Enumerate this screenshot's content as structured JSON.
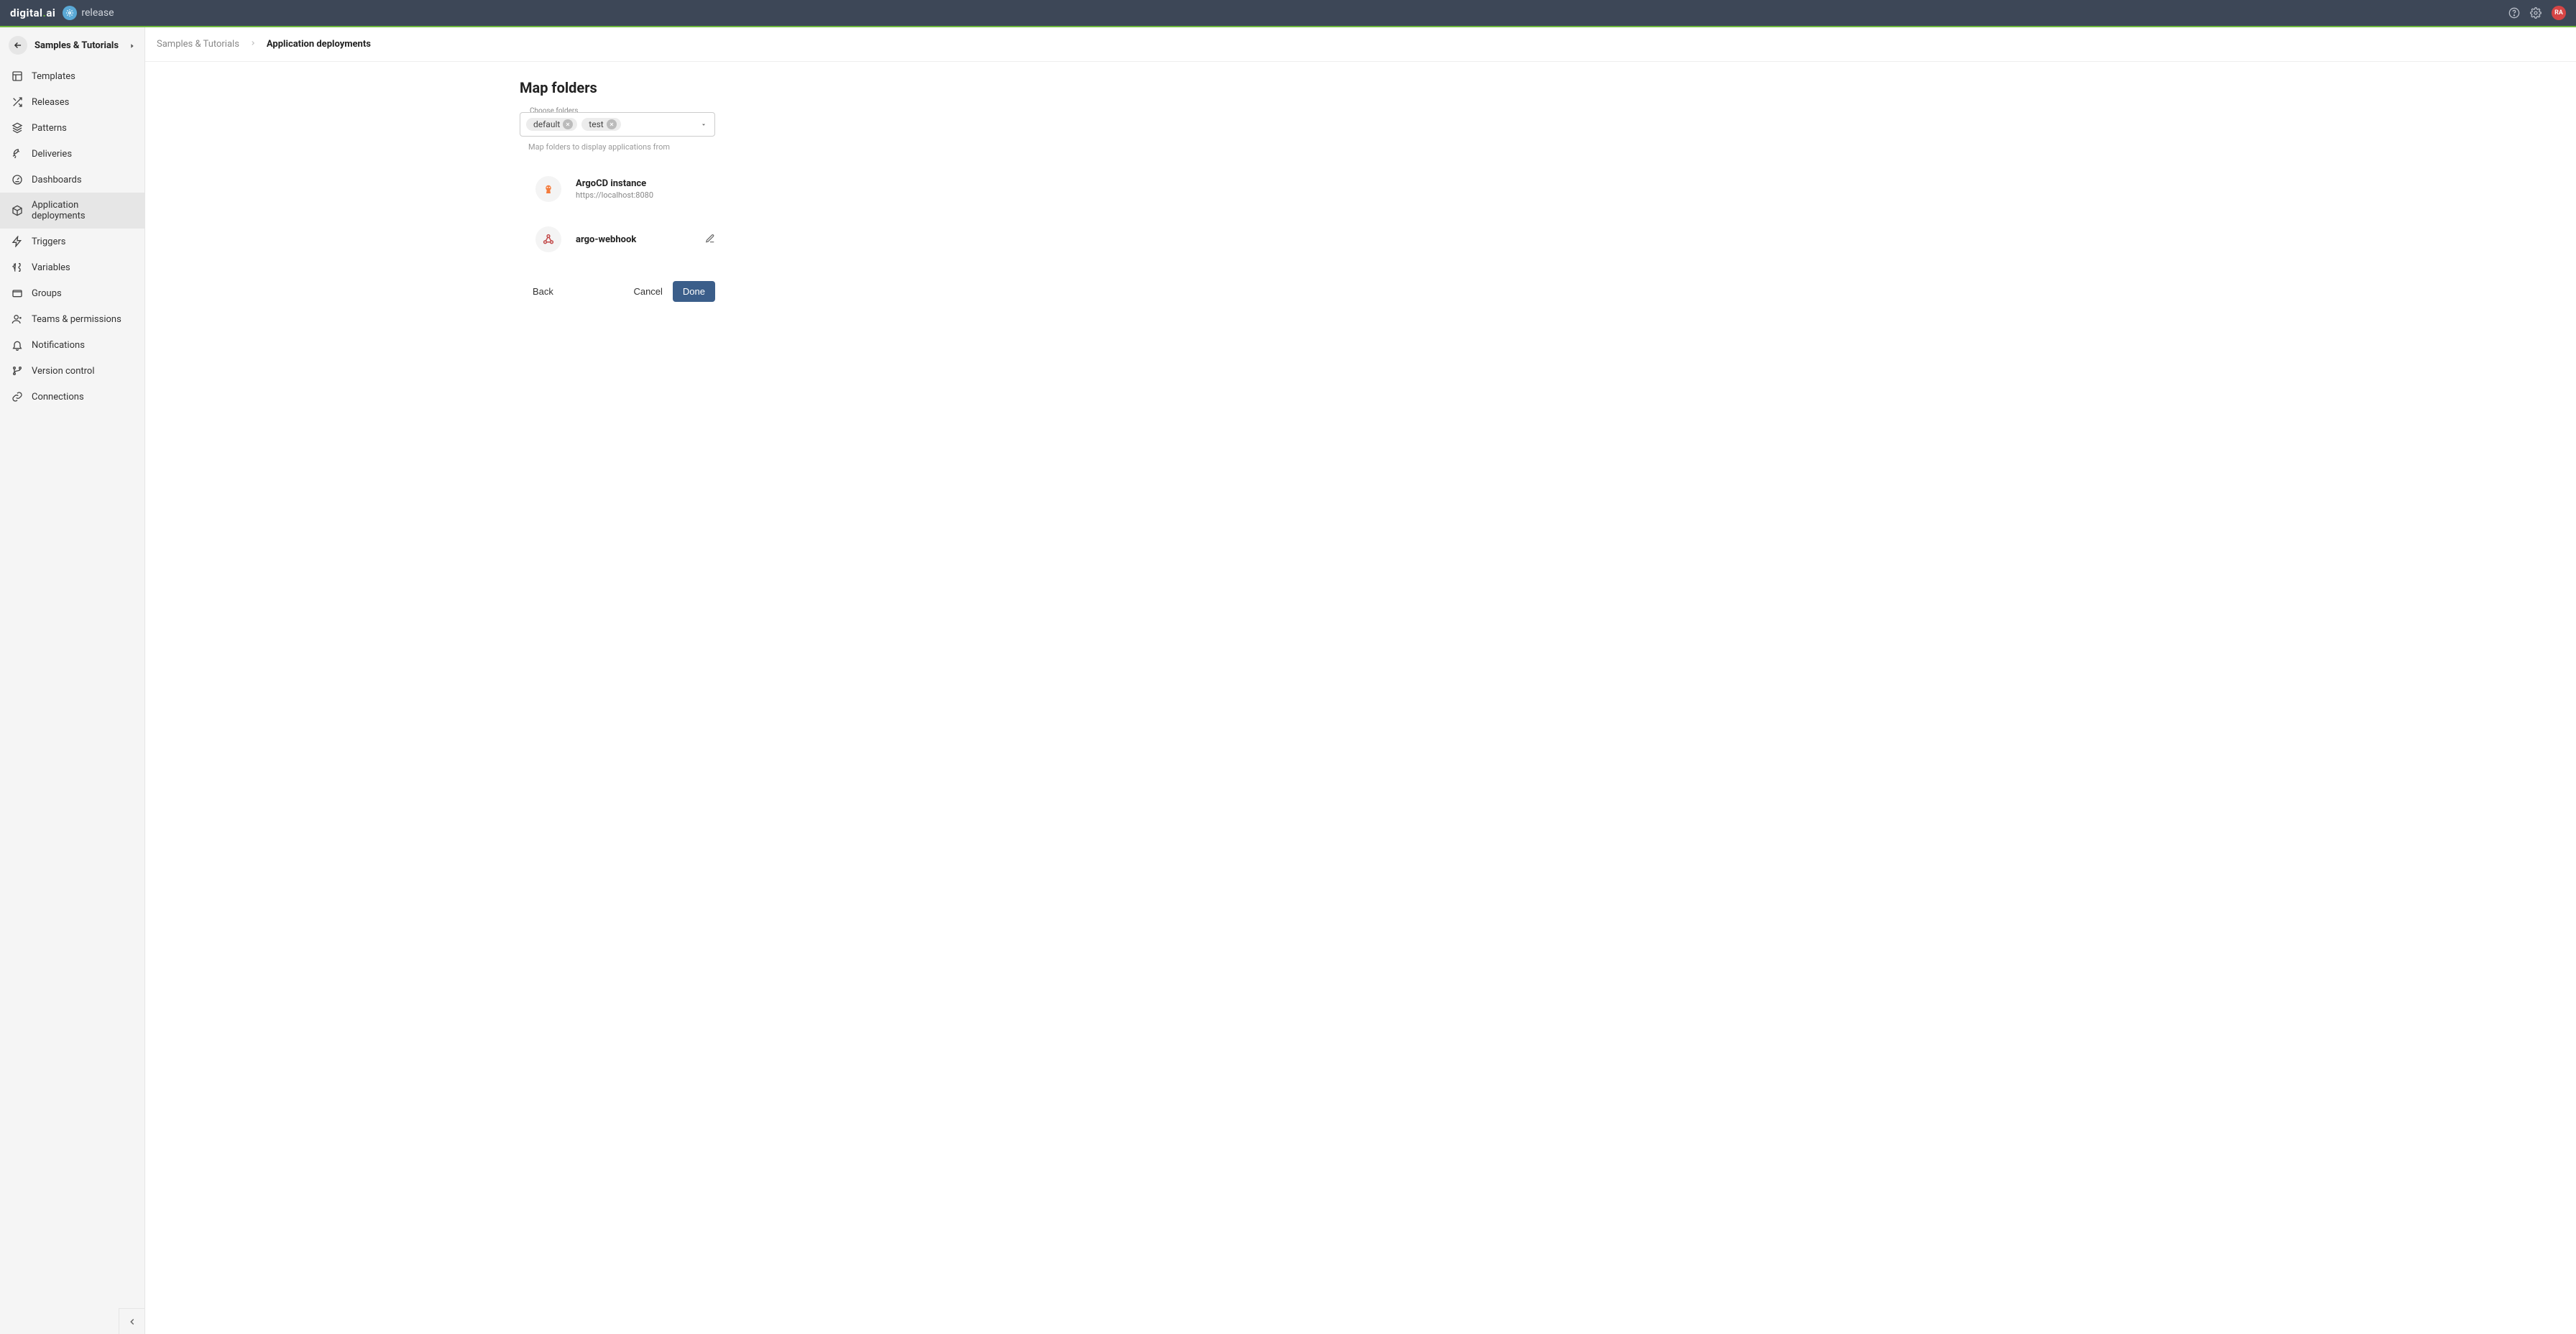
{
  "brand": {
    "name": "digital.ai",
    "product": "release"
  },
  "header": {
    "avatar_initials": "RA"
  },
  "sidebar": {
    "title": "Samples & Tutorials",
    "items": [
      {
        "label": "Templates"
      },
      {
        "label": "Releases"
      },
      {
        "label": "Patterns"
      },
      {
        "label": "Deliveries"
      },
      {
        "label": "Dashboards"
      },
      {
        "label": "Application deployments"
      },
      {
        "label": "Triggers"
      },
      {
        "label": "Variables"
      },
      {
        "label": "Groups"
      },
      {
        "label": "Teams & permissions"
      },
      {
        "label": "Notifications"
      },
      {
        "label": "Version control"
      },
      {
        "label": "Connections"
      }
    ]
  },
  "breadcrumb": {
    "parent": "Samples & Tutorials",
    "current": "Application deployments"
  },
  "page": {
    "title": "Map folders",
    "field_label": "Choose folders",
    "chips": [
      "default",
      "test"
    ],
    "helper": "Map folders to display applications from",
    "instance": {
      "name": "ArgoCD instance",
      "url": "https://localhost:8080"
    },
    "webhook": {
      "name": "argo-webhook"
    },
    "actions": {
      "back": "Back",
      "cancel": "Cancel",
      "done": "Done"
    }
  }
}
